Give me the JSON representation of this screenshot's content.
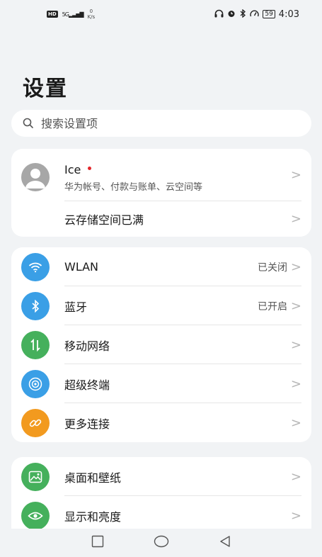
{
  "status_bar": {
    "hd": "HD",
    "network_type": "5G",
    "net_speed_value": "0",
    "net_speed_unit": "K/s",
    "battery": "59",
    "time": "4:03"
  },
  "page": {
    "title": "设置"
  },
  "search": {
    "placeholder": "搜索设置项"
  },
  "account": {
    "name": "Ice",
    "subtitle": "华为帐号、付款与账单、云空间等",
    "cloud_label": "云存储空间已满"
  },
  "connectivity": {
    "items": [
      {
        "label": "WLAN",
        "value": "已关闭",
        "icon": "wifi-icon",
        "color": "#3a9fe6"
      },
      {
        "label": "蓝牙",
        "value": "已开启",
        "icon": "bluetooth-icon",
        "color": "#3a9fe6"
      },
      {
        "label": "移动网络",
        "value": "",
        "icon": "mobile-data-icon",
        "color": "#45b05c"
      },
      {
        "label": "超级终端",
        "value": "",
        "icon": "super-device-icon",
        "color": "#3a9fe6"
      },
      {
        "label": "更多连接",
        "value": "",
        "icon": "link-icon",
        "color": "#f29a1f"
      }
    ]
  },
  "display": {
    "items": [
      {
        "label": "桌面和壁纸",
        "icon": "wallpaper-icon",
        "color": "#45b05c"
      },
      {
        "label": "显示和亮度",
        "icon": "eye-icon",
        "color": "#45b05c"
      }
    ]
  }
}
